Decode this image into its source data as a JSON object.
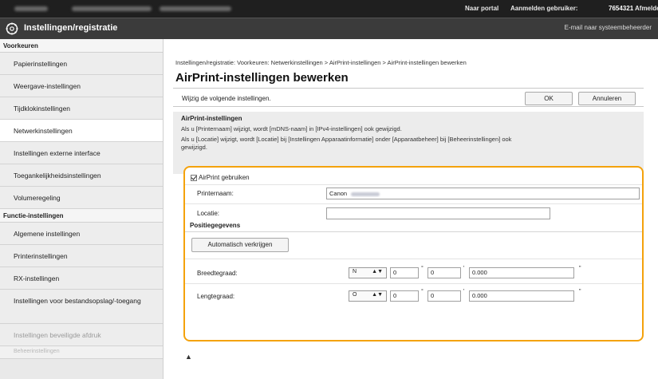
{
  "header": {
    "portal_link": "Naar portal",
    "user_label": "Aanmelden gebruiker:",
    "user_id": "7654321",
    "logout": "Afmelden",
    "app_title": "Instellingen/registratie",
    "mail_link": "E-mail naar systeembeheerder"
  },
  "sidebar": {
    "group1": "Voorkeuren",
    "items1": [
      "Papierinstellingen",
      "Weergave-instellingen",
      "Tijdklokinstellingen",
      "Netwerkinstellingen",
      "Instellingen externe interface",
      "Toegankelijkheidsinstellingen",
      "Volumeregeling"
    ],
    "group2": "Functie-instellingen",
    "items2": [
      "Algemene instellingen",
      "Printerinstellingen",
      "RX-instellingen",
      "Instellingen voor bestandsopslag/-toegang",
      "Instellingen beveiligde afdruk",
      "Beheerinstellingen"
    ]
  },
  "main": {
    "breadcrumb": "Instellingen/registratie: Voorkeuren: Netwerkinstellingen > AirPrint-instellingen > AirPrint-instellingen bewerken",
    "title": "AirPrint-instellingen bewerken",
    "instruction": "Wijzig de volgende instellingen.",
    "ok_label": "OK",
    "cancel_label": "Annuleren",
    "section_title": "AirPrint-instellingen",
    "note1": "Als u [Printernaam] wijzigt, wordt [mDNS-naam] in [IPv4-instellingen] ook gewijzigd.",
    "note2": "Als u [Locatie] wijzigt, wordt [Locatie] bij [Instellingen Apparaatinformatie] onder [Apparaatbeheer] bij [Beheerinstellingen] ook",
    "note3": "gewijzigd.",
    "use_airprint": "AirPrint gebruiken",
    "printer_name_label": "Printernaam:",
    "printer_name_value": "Canon",
    "location_label": "Locatie:",
    "location_value": "",
    "position_title": "Positiegegevens",
    "auto_button": "Automatisch verkrijgen",
    "latitude_label": "Breedtegraad:",
    "latitude_dir": "N",
    "latitude_deg": "0",
    "latitude_min": "0",
    "latitude_sec": "0.000",
    "longitude_label": "Lengtegraad:",
    "longitude_dir": "O",
    "longitude_deg": "0",
    "longitude_min": "0",
    "longitude_sec": "0.000",
    "degree_unit": "°",
    "minute_unit": "'",
    "second_unit": "\"",
    "top_link": "▲"
  },
  "colors": {
    "accent": "#f4a20c",
    "topbar": "#1f1f1f",
    "titlebar": "#3b3b3b"
  }
}
